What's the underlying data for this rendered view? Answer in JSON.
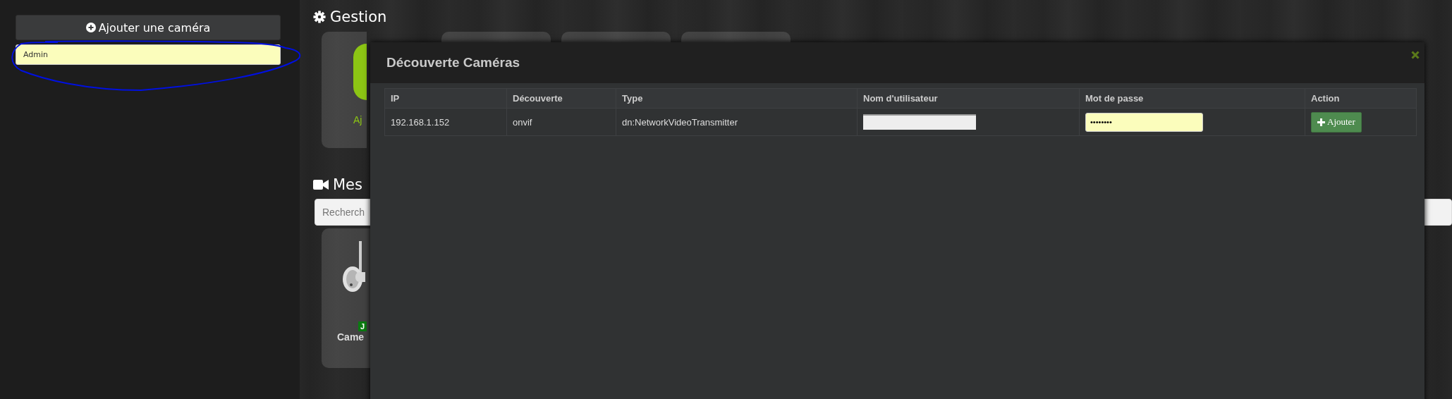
{
  "sidebar": {
    "add_button": {
      "label": "Ajouter une caméra"
    },
    "user_field": {
      "value": "Admin"
    }
  },
  "gestion": {
    "title": "Gestion",
    "cards": [
      {
        "kind": "add",
        "label": "Aj"
      },
      {
        "kind": "blank"
      },
      {
        "kind": "blank"
      },
      {
        "kind": "blank"
      }
    ]
  },
  "cameras": {
    "title": "Mes",
    "search": {
      "placeholder": "Recherch"
    },
    "items": [
      {
        "name": "Came",
        "badge": "J"
      }
    ]
  },
  "modal": {
    "title": "Découverte Caméras",
    "table": {
      "columns": [
        "IP",
        "Découverte",
        "Type",
        "Nom d'utilisateur",
        "Mot de passe",
        "Action"
      ],
      "rows": [
        {
          "ip": "192.168.1.152",
          "discovery": "onvif",
          "type": "dn:NetworkVideoTransmitter",
          "password": "••••••••",
          "action": "Ajouter"
        }
      ]
    }
  }
}
